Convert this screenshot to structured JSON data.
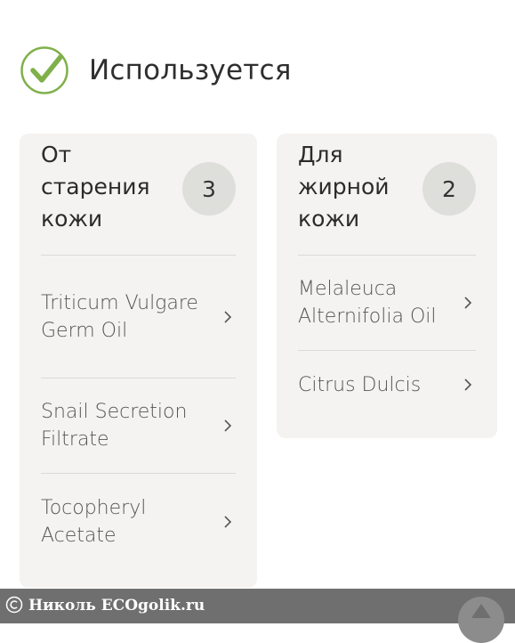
{
  "header": {
    "status_label": "Используется",
    "icon": "check-circle-icon",
    "accent_color": "#7fb04a"
  },
  "categories": [
    {
      "title": "От старения кожи",
      "count": "3",
      "items": [
        "Triticum Vulgare Germ Oil",
        "Snail Secretion Filtrate",
        "Tocopheryl Acetate"
      ]
    },
    {
      "title": "Для жирной кожи",
      "count": "2",
      "items": [
        "Melaleuca Alternifolia Oil",
        "Citrus Dulcis"
      ]
    }
  ],
  "footer": {
    "copyright_icon": "copyright-icon",
    "text": "Николь ECOgolik.ru",
    "scroll_top_icon": "arrow-up-icon"
  }
}
